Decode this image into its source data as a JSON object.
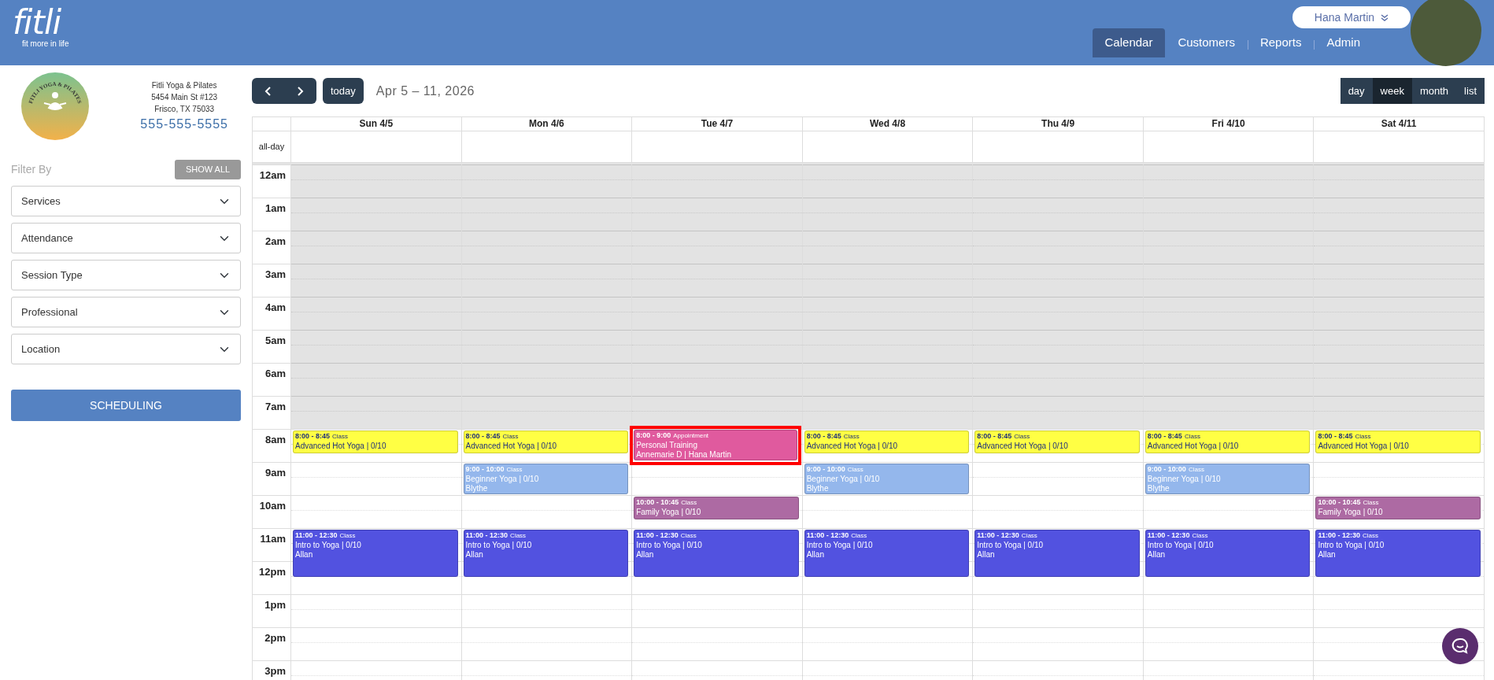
{
  "brand": {
    "name": "fitli",
    "tagline": "fit more in life"
  },
  "user": {
    "name": "Hana Martin"
  },
  "nav": [
    {
      "label": "Calendar",
      "selected": true
    },
    {
      "label": "Customers",
      "selected": false
    },
    {
      "label": "Reports",
      "selected": false
    },
    {
      "label": "Admin",
      "selected": false
    }
  ],
  "studio": {
    "logo_text": "FITLI YOGA & PILATES",
    "name": "Fitli Yoga & Pilates",
    "address_1": "5454 Main St #123",
    "address_2": "Frisco, TX 75033",
    "phone": "555-555-5555"
  },
  "filters": {
    "label": "Filter By",
    "show_all": "SHOW ALL",
    "selects": [
      "Services",
      "Attendance",
      "Session Type",
      "Professional",
      "Location"
    ],
    "scheduling": "SCHEDULING"
  },
  "toolbar": {
    "title": "Apr 5 – 11, 2026",
    "today": "today",
    "views": [
      {
        "label": "day",
        "selected": false
      },
      {
        "label": "week",
        "selected": true
      },
      {
        "label": "month",
        "selected": false
      },
      {
        "label": "list",
        "selected": false
      }
    ]
  },
  "calendar": {
    "all_day_label": "all-day",
    "hours": [
      {
        "label": "12am",
        "shaded": true
      },
      {
        "label": "1am",
        "shaded": true
      },
      {
        "label": "2am",
        "shaded": true
      },
      {
        "label": "3am",
        "shaded": true
      },
      {
        "label": "4am",
        "shaded": true
      },
      {
        "label": "5am",
        "shaded": true
      },
      {
        "label": "6am",
        "shaded": true
      },
      {
        "label": "7am",
        "shaded": true
      },
      {
        "label": "8am",
        "shaded": false
      },
      {
        "label": "9am",
        "shaded": false
      },
      {
        "label": "10am",
        "shaded": false
      },
      {
        "label": "11am",
        "shaded": false
      },
      {
        "label": "12pm",
        "shaded": false
      },
      {
        "label": "1pm",
        "shaded": false
      },
      {
        "label": "2pm",
        "shaded": false
      },
      {
        "label": "3pm",
        "shaded": false
      }
    ],
    "days": [
      {
        "label": "Sun 4/5",
        "events": [
          {
            "time": "8:00 - 8:45",
            "type": "Class",
            "title": "Advanced Hot Yoga | 0/10",
            "color": "#ffff44",
            "highlighted": false
          },
          {
            "time": "11:00 - 12:30",
            "type": "Class",
            "title": "Intro to Yoga | 0/10",
            "staff": "Allan",
            "color": "#5252e0",
            "highlighted": false
          }
        ]
      },
      {
        "label": "Mon 4/6",
        "events": [
          {
            "time": "8:00 - 8:45",
            "type": "Class",
            "title": "Advanced Hot Yoga | 0/10",
            "color": "#ffff44",
            "highlighted": false
          },
          {
            "time": "9:00 - 10:00",
            "type": "Class",
            "title": "Beginner Yoga | 0/10",
            "staff": "Blythe",
            "color": "#94b7ec",
            "highlighted": false
          },
          {
            "time": "11:00 - 12:30",
            "type": "Class",
            "title": "Intro to Yoga | 0/10",
            "staff": "Allan",
            "color": "#5252e0",
            "highlighted": false
          }
        ]
      },
      {
        "label": "Tue 4/7",
        "events": [
          {
            "time": "8:00 - 9:00",
            "type": "Appointment",
            "title": "Personal Training",
            "staff": "Annemarie D | Hana Martin",
            "color": "#e05a9e",
            "highlighted": true
          },
          {
            "time": "10:00 - 10:45",
            "type": "Class",
            "title": "Family Yoga | 0/10",
            "color": "#ad6aa3",
            "highlighted": false
          },
          {
            "time": "11:00 - 12:30",
            "type": "Class",
            "title": "Intro to Yoga | 0/10",
            "staff": "Allan",
            "color": "#5252e0",
            "highlighted": false
          }
        ]
      },
      {
        "label": "Wed 4/8",
        "events": [
          {
            "time": "8:00 - 8:45",
            "type": "Class",
            "title": "Advanced Hot Yoga | 0/10",
            "color": "#ffff44",
            "highlighted": false
          },
          {
            "time": "9:00 - 10:00",
            "type": "Class",
            "title": "Beginner Yoga | 0/10",
            "staff": "Blythe",
            "color": "#94b7ec",
            "highlighted": false
          },
          {
            "time": "11:00 - 12:30",
            "type": "Class",
            "title": "Intro to Yoga | 0/10",
            "staff": "Allan",
            "color": "#5252e0",
            "highlighted": false
          }
        ]
      },
      {
        "label": "Thu 4/9",
        "events": [
          {
            "time": "8:00 - 8:45",
            "type": "Class",
            "title": "Advanced Hot Yoga | 0/10",
            "color": "#ffff44",
            "highlighted": false
          },
          {
            "time": "11:00 - 12:30",
            "type": "Class",
            "title": "Intro to Yoga | 0/10",
            "staff": "Allan",
            "color": "#5252e0",
            "highlighted": false
          }
        ]
      },
      {
        "label": "Fri 4/10",
        "events": [
          {
            "time": "8:00 - 8:45",
            "type": "Class",
            "title": "Advanced Hot Yoga | 0/10",
            "color": "#ffff44",
            "highlighted": false
          },
          {
            "time": "9:00 - 10:00",
            "type": "Class",
            "title": "Beginner Yoga | 0/10",
            "staff": "Blythe",
            "color": "#94b7ec",
            "highlighted": false
          },
          {
            "time": "11:00 - 12:30",
            "type": "Class",
            "title": "Intro to Yoga | 0/10",
            "staff": "Allan",
            "color": "#5252e0",
            "highlighted": false
          }
        ]
      },
      {
        "label": "Sat 4/11",
        "events": [
          {
            "time": "8:00 - 8:45",
            "type": "Class",
            "title": "Advanced Hot Yoga | 0/10",
            "color": "#ffff44",
            "highlighted": false
          },
          {
            "time": "10:00 - 10:45",
            "type": "Class",
            "title": "Family Yoga | 0/10",
            "color": "#ad6aa3",
            "highlighted": false
          },
          {
            "time": "11:00 - 12:30",
            "type": "Class",
            "title": "Intro to Yoga | 0/10",
            "staff": "Allan",
            "color": "#5252e0",
            "highlighted": false
          }
        ]
      }
    ]
  }
}
